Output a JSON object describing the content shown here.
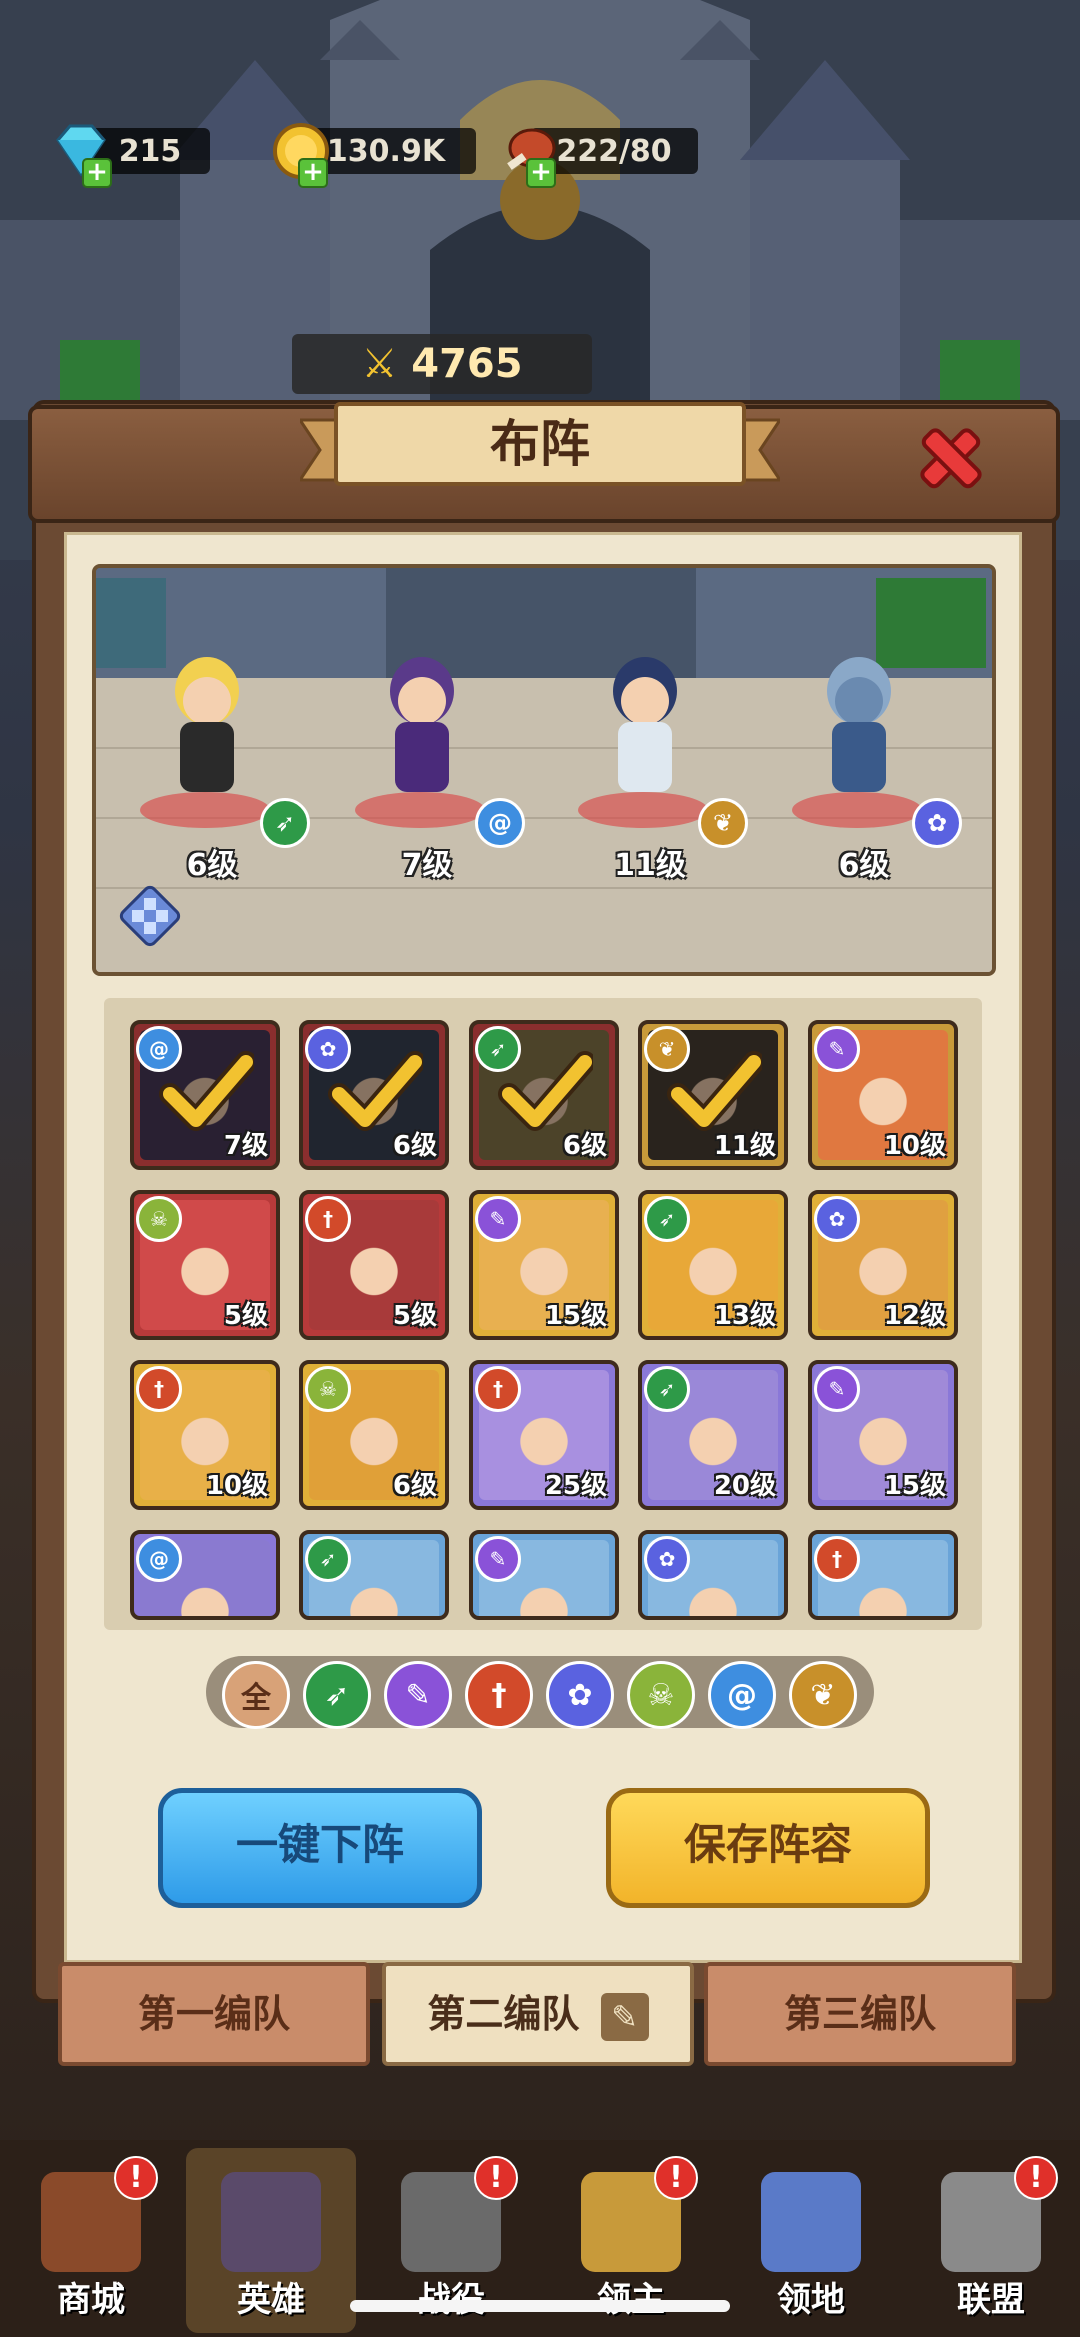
{
  "currency": {
    "gems": "215",
    "gold": "130.9K",
    "stamina": "222/80"
  },
  "panel": {
    "title": "布阵"
  },
  "scene": {
    "heroes": [
      {
        "level": "6级",
        "class": "bow",
        "class_color": "#2e9a48"
      },
      {
        "level": "7级",
        "class": "swirl",
        "class_color": "#3e8ee0"
      },
      {
        "level": "11级",
        "class": "wing",
        "class_color": "#c8902a"
      },
      {
        "level": "6级",
        "class": "paw",
        "class_color": "#5a62e0"
      }
    ],
    "power": "4765"
  },
  "roster": [
    {
      "level": "7级",
      "class": "swirl",
      "class_color": "#3e8ee0",
      "frame": "#8a2e2e",
      "selected": true,
      "portrait": "#4a3a5a"
    },
    {
      "level": "6级",
      "class": "paw",
      "class_color": "#5a62e0",
      "frame": "#8a2e2e",
      "selected": true,
      "portrait": "#3a4456"
    },
    {
      "level": "6级",
      "class": "bow",
      "class_color": "#2e9a48",
      "frame": "#8a2e2e",
      "selected": true,
      "portrait": "#8a7a4a"
    },
    {
      "level": "11级",
      "class": "wing",
      "class_color": "#c8902a",
      "frame": "#c89a3a",
      "selected": true,
      "portrait": "#4a4034"
    },
    {
      "level": "10级",
      "class": "staff",
      "class_color": "#8a52d8",
      "frame": "#c89a3a",
      "selected": false,
      "portrait": "#e07840"
    },
    {
      "level": "5级",
      "class": "skull",
      "class_color": "#8ab43a",
      "frame": "#b83a3a",
      "selected": false,
      "portrait": "#d04a4a"
    },
    {
      "level": "5级",
      "class": "sword",
      "class_color": "#d24a2a",
      "frame": "#b83a3a",
      "selected": false,
      "portrait": "#a83a3a"
    },
    {
      "level": "15级",
      "class": "staff",
      "class_color": "#8a52d8",
      "frame": "#e0b038",
      "selected": false,
      "portrait": "#e8b050"
    },
    {
      "level": "13级",
      "class": "bow",
      "class_color": "#2e9a48",
      "frame": "#e0b038",
      "selected": false,
      "portrait": "#e8a838"
    },
    {
      "level": "12级",
      "class": "paw",
      "class_color": "#5a62e0",
      "frame": "#e0b038",
      "selected": false,
      "portrait": "#e0a040"
    },
    {
      "level": "10级",
      "class": "sword",
      "class_color": "#d24a2a",
      "frame": "#e0b038",
      "selected": false,
      "portrait": "#e8b048"
    },
    {
      "level": "6级",
      "class": "skull",
      "class_color": "#8ab43a",
      "frame": "#e0b038",
      "selected": false,
      "portrait": "#e0a038"
    },
    {
      "level": "25级",
      "class": "sword",
      "class_color": "#d24a2a",
      "frame": "#8a78d8",
      "selected": false,
      "portrait": "#a890e0"
    },
    {
      "level": "20级",
      "class": "bow",
      "class_color": "#2e9a48",
      "frame": "#8a78d8",
      "selected": false,
      "portrait": "#9a88d8"
    },
    {
      "level": "15级",
      "class": "staff",
      "class_color": "#8a52d8",
      "frame": "#8a78d8",
      "selected": false,
      "portrait": "#a08ad8"
    },
    {
      "level": "",
      "class": "swirl",
      "class_color": "#3e8ee0",
      "frame": "#8a78d8",
      "selected": false,
      "portrait": "#8a7ad0"
    },
    {
      "level": "",
      "class": "bow",
      "class_color": "#2e9a48",
      "frame": "#6aa4d8",
      "selected": false,
      "portrait": "#88b8e0"
    },
    {
      "level": "",
      "class": "staff",
      "class_color": "#8a52d8",
      "frame": "#6aa4d8",
      "selected": false,
      "portrait": "#88b8e0"
    },
    {
      "level": "",
      "class": "paw",
      "class_color": "#5a62e0",
      "frame": "#6aa4d8",
      "selected": false,
      "portrait": "#88b8e0"
    },
    {
      "level": "",
      "class": "sword",
      "class_color": "#d24a2a",
      "frame": "#6aa4d8",
      "selected": false,
      "portrait": "#88b8e0"
    }
  ],
  "filters": [
    {
      "label": "全",
      "name": "all",
      "color": "#d8a278"
    },
    {
      "label": "",
      "name": "bow",
      "color": "#2e9a48"
    },
    {
      "label": "",
      "name": "staff",
      "color": "#8a52d8"
    },
    {
      "label": "",
      "name": "sword",
      "color": "#d24a2a"
    },
    {
      "label": "",
      "name": "paw",
      "color": "#5a62e0"
    },
    {
      "label": "",
      "name": "skull",
      "color": "#8ab43a"
    },
    {
      "label": "",
      "name": "swirl",
      "color": "#3e8ee0"
    },
    {
      "label": "",
      "name": "wing",
      "color": "#c8902a"
    }
  ],
  "buttons": {
    "unequip_all": "一键下阵",
    "save": "保存阵容"
  },
  "teams": [
    "第一编队",
    "第二编队",
    "第三编队"
  ],
  "nav": [
    {
      "label": "商城",
      "alert": true,
      "color": "#8a4a2a"
    },
    {
      "label": "英雄",
      "alert": false,
      "color": "#5a4a6a",
      "active": true
    },
    {
      "label": "战役",
      "alert": true,
      "color": "#6a6a6a"
    },
    {
      "label": "领主",
      "alert": true,
      "color": "#c89a3a"
    },
    {
      "label": "领地",
      "alert": false,
      "color": "#5a7ac8"
    },
    {
      "label": "联盟",
      "alert": true,
      "color": "#8a8a8a"
    }
  ]
}
